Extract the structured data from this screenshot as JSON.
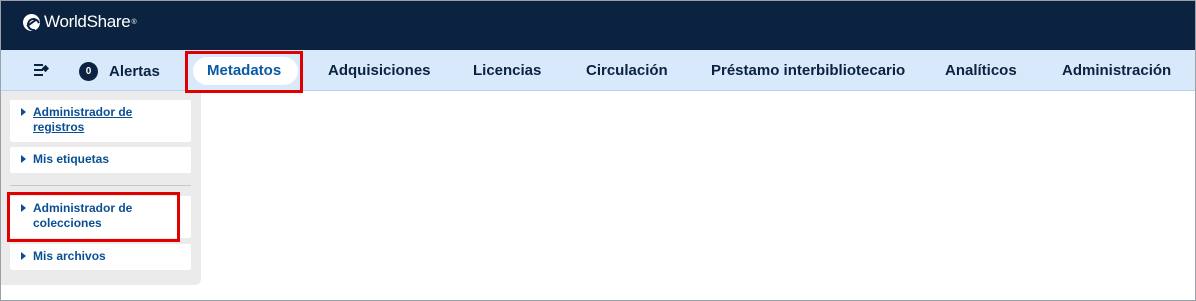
{
  "app": {
    "brand_name": "WorldShare",
    "brand_tm": "®"
  },
  "alerts": {
    "count": "0",
    "label": "Alertas"
  },
  "nav": {
    "tabs": [
      {
        "label": "Metadatos",
        "active": true
      },
      {
        "label": "Adquisiciones"
      },
      {
        "label": "Licencias"
      },
      {
        "label": "Circulación"
      },
      {
        "label": "Préstamo interbibliotecario"
      },
      {
        "label": "Analíticos"
      },
      {
        "label": "Administración"
      }
    ]
  },
  "sidebar": {
    "items": [
      {
        "label": "Administrador de registros"
      },
      {
        "label": "Mis etiquetas"
      },
      {
        "label": "Administrador de colecciones"
      },
      {
        "label": "Mis archivos"
      }
    ]
  },
  "colors": {
    "header_bg": "#0b2340",
    "nav_bg": "#d8e9fb",
    "link": "#0a4f93",
    "highlight": "#e00000"
  }
}
